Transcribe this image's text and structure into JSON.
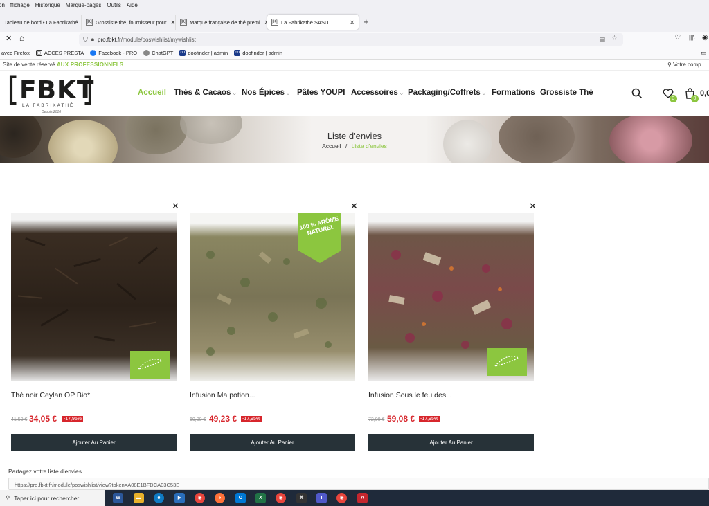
{
  "browser": {
    "menu": [
      "ffichage",
      "Historique",
      "Marque-pages",
      "Outils",
      "Aide"
    ],
    "menu_first": "on",
    "tabs": [
      {
        "label": "Tableau de bord • La Fabrikathé"
      },
      {
        "label": "Grossiste thé, fournisseur pour"
      },
      {
        "label": "Marque française de thé premi"
      },
      {
        "label": "La Fabrikathé SASU"
      }
    ],
    "url_host": "pro.fbkt.fr",
    "url_path": "/module/poswishlist/mywishlist",
    "bookmarks": [
      "avec Firefox",
      "ACCES PRESTA",
      "Facebook - PRO",
      "ChatGPT",
      "doofinder | admin",
      "doofinder | admin"
    ]
  },
  "site": {
    "topstrip_left": "Site de vente réservé ",
    "topstrip_highlight": "AUX PROFESSIONNELS",
    "topstrip_right": "Votre comp",
    "logo": {
      "text": "FBKT",
      "sub": "LA FABRIKATHÉ",
      "since": "Depuis 2016"
    },
    "nav": [
      {
        "label": "Accueil",
        "active": true,
        "chev": false
      },
      {
        "label": "Thés & Cacaos",
        "chev": true
      },
      {
        "label": "Nos Épices",
        "chev": true
      },
      {
        "label": "Pâtes YOUPI",
        "chev": false
      },
      {
        "label": "Accessoires",
        "chev": true
      },
      {
        "label": "Packaging/Coffrets",
        "chev": true
      },
      {
        "label": "Formations",
        "chev": false
      },
      {
        "label": "Grossiste Thé",
        "chev": false
      }
    ],
    "chev": "⌵",
    "wishlist_count": "3",
    "cart_count": "0",
    "cart_total": "0,0"
  },
  "banner": {
    "title": "Liste d'envies",
    "crumb_home": "Accueil",
    "crumb_sep": "/",
    "crumb_current": "Liste d'envies"
  },
  "products": [
    {
      "name": "Thé noir Ceylan OP Bio*",
      "old_price": "41,50 €",
      "price": "34,05 €",
      "discount": "-17,95%",
      "bio": true,
      "badge": null
    },
    {
      "name": "Infusion Ma potion...",
      "old_price": "60,00 €",
      "price": "49,23 €",
      "discount": "-17,95%",
      "bio": false,
      "badge": "100 % ARÔME NATUREL"
    },
    {
      "name": "Infusion Sous le feu des...",
      "old_price": "72,00 €",
      "price": "59,08 €",
      "discount": "-17,95%",
      "bio": true,
      "badge": null
    }
  ],
  "cart_button": "Ajouter Au Panier",
  "share": {
    "label": "Partagez votre liste d'envies",
    "url": "https://pro.fbkt.fr/module/poswishlist/view?token=A08E1BFDCA03C53E"
  },
  "taskbar": {
    "search": "Taper ici pour rechercher"
  },
  "colors": {
    "accent": "#8cc63f",
    "price": "#d7262c",
    "button": "#273238"
  }
}
